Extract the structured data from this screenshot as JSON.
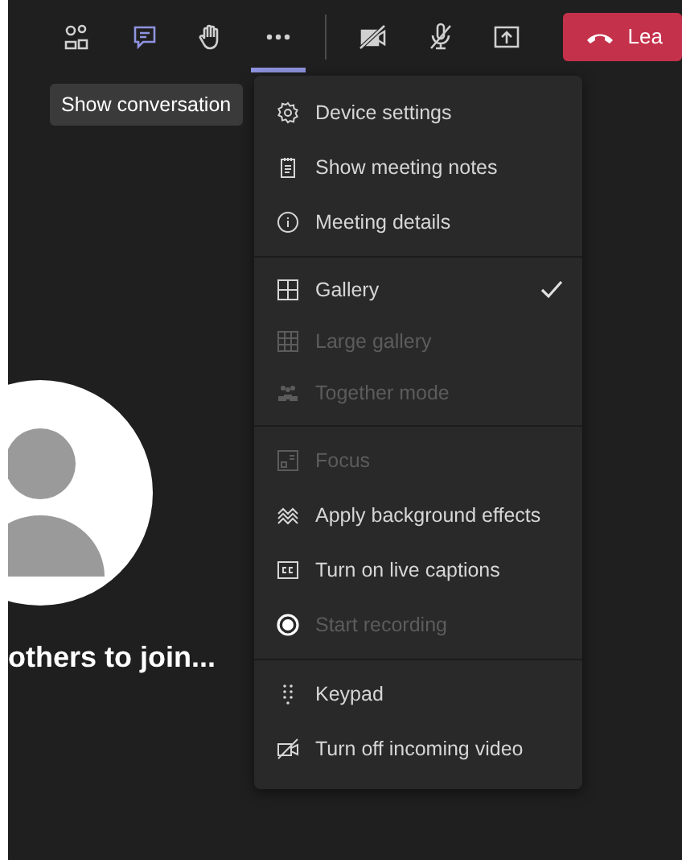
{
  "toolbar": {
    "buttons": [
      {
        "selected": false,
        "highlighted": false
      },
      {
        "selected": false,
        "highlighted": true
      },
      {
        "selected": false,
        "highlighted": false
      },
      {
        "selected": true,
        "highlighted": false
      },
      {
        "selected": false,
        "highlighted": false
      },
      {
        "selected": false,
        "highlighted": false
      },
      {
        "selected": false,
        "highlighted": false
      }
    ],
    "leave_button": {
      "label": "Lea"
    }
  },
  "tooltip": {
    "text": "Show conversation"
  },
  "menu": {
    "groups": [
      {
        "items": [
          {
            "label": "Device settings",
            "disabled": false,
            "checked": false
          },
          {
            "label": "Show meeting notes",
            "disabled": false,
            "checked": false
          },
          {
            "label": "Meeting details",
            "disabled": false,
            "checked": false
          }
        ]
      },
      {
        "items": [
          {
            "label": "Gallery",
            "disabled": false,
            "checked": true
          },
          {
            "label": "Large gallery",
            "disabled": true,
            "checked": false
          },
          {
            "label": "Together mode",
            "disabled": true,
            "checked": false
          }
        ]
      },
      {
        "items": [
          {
            "label": "Focus",
            "disabled": true,
            "checked": false
          },
          {
            "label": "Apply background effects",
            "disabled": false,
            "checked": false
          },
          {
            "label": "Turn on live captions",
            "disabled": false,
            "checked": false
          },
          {
            "label": "Start recording",
            "disabled": true,
            "checked": false
          }
        ]
      },
      {
        "items": [
          {
            "label": "Keypad",
            "disabled": false,
            "checked": false
          },
          {
            "label": "Turn off incoming video",
            "disabled": false,
            "checked": false
          }
        ]
      }
    ]
  },
  "stage": {
    "waiting_text": "others to join..."
  }
}
